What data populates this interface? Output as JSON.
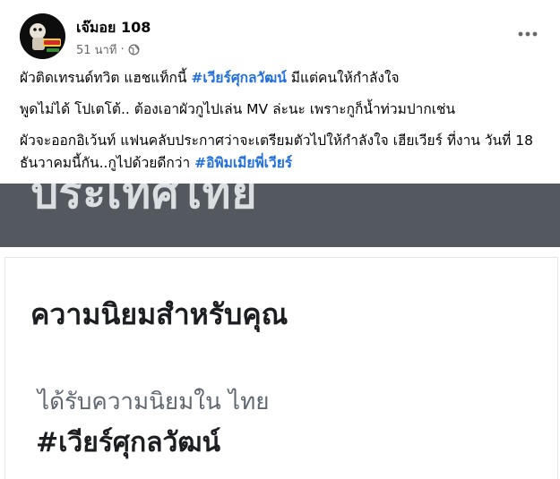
{
  "author": {
    "name": "เจ๊มอย 108",
    "time": "51 นาที",
    "privacy_icon": "globe-icon"
  },
  "header": {
    "more_icon": "more-horizontal-icon"
  },
  "post": {
    "line1_text": "ผัวติดเทรนด์ทวิต แฮชแท็กนี้ ",
    "line1_hashtag": "#เวียร์ศุกลวัฒน์",
    "line1_tail": "  มีแต่คนให้กำลังใจ",
    "line2_text": "พูดไม่ได้ โปเตโต้.. ต้องเอาผัวกูไปเล่น MV ล่ะนะ เพราะกูก็น้ำท่วมปากเช่น",
    "line3_text": "ผัวจะออกอิเว้นท์ แฟนคลับประกาศว่าจะเตรียมตัวไปให้กำลังใจ เฮียเวียร์ ที่งาน วันที่ 18 ธันวาคมนี้กัน..กูไปด้วยดีกว่า ",
    "line3_hashtag": "#อิพิมเมียพี่เวียร์"
  },
  "attachment": {
    "country_text": "ประเทศไทย",
    "heading": "ความนิยมสำหรับคุณ",
    "trend_label": "ได้รับความนิยมใน ไทย",
    "trend_tag": "#เวียร์ศุกลวัฒน์"
  },
  "colors": {
    "hashtag": "#216fdb",
    "meta_text": "#65676b",
    "banner": "#53595f"
  }
}
